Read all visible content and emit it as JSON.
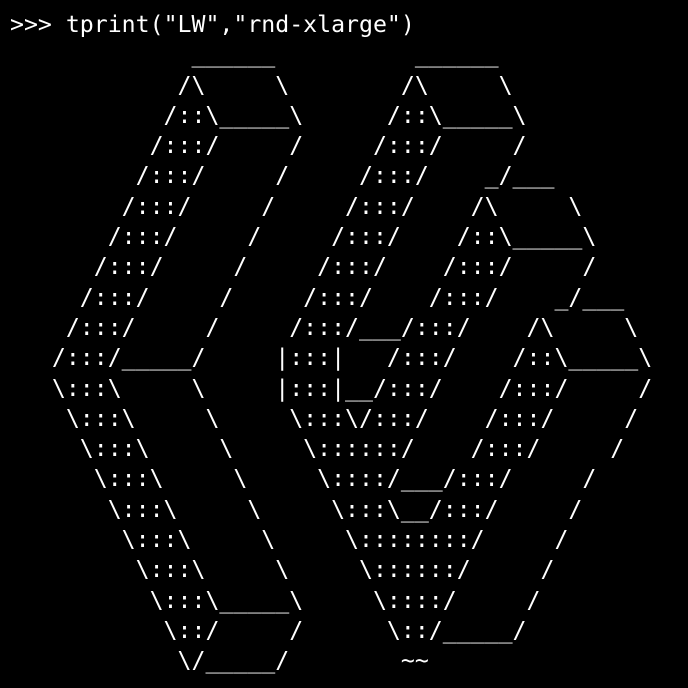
{
  "terminal": {
    "prompt": ">>> ",
    "command": "tprint(\"LW\",\"rnd-xlarge\")",
    "output_lines": [
      "             ______          ______",
      "            /\\     \\        /\\     \\",
      "           /::\\_____\\      /::\\_____\\",
      "          /:::/     /     /:::/     /",
      "         /:::/     /     /:::/    _/___",
      "        /:::/     /     /:::/    /\\     \\",
      "       /:::/     /     /:::/    /::\\_____\\",
      "      /:::/     /     /:::/    /:::/     /",
      "     /:::/     /     /:::/    /:::/    _/___",
      "    /:::/     /     /:::/___/:::/    /\\     \\",
      "   /:::/_____/     |:::|   /:::/    /::\\_____\\",
      "   \\:::\\     \\     |:::|__/:::/    /:::/     /",
      "    \\:::\\     \\     \\:::\\/:::/    /:::/     /",
      "     \\:::\\     \\     \\::::::/    /:::/     /",
      "      \\:::\\     \\     \\::::/___/:::/     /",
      "       \\:::\\     \\     \\:::\\__/:::/     /",
      "        \\:::\\     \\     \\::::::::/     /",
      "         \\:::\\     \\     \\::::::/     /",
      "          \\:::\\_____\\     \\::::/     /",
      "           \\::/     /      \\::/_____/",
      "            \\/_____/        ~~"
    ]
  }
}
